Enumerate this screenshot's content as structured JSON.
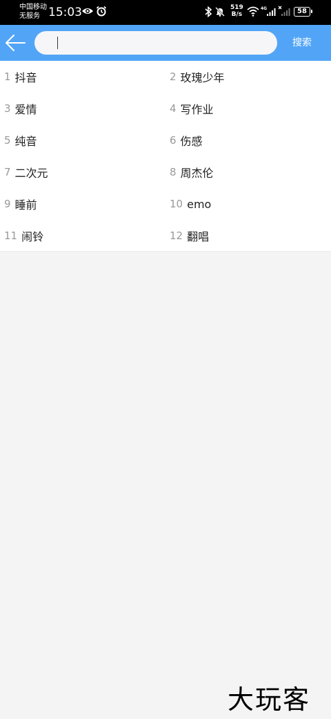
{
  "status": {
    "carrier_line1": "中国移动",
    "carrier_line2": "无服务",
    "time": "15:03",
    "net_speed_value": "519",
    "net_speed_unit": "B/s",
    "network_type": "4G",
    "battery": "58",
    "icons": [
      "eye-icon",
      "alarm-icon",
      "bluetooth-icon",
      "mute-bell-icon",
      "wifi-icon",
      "signal-icon",
      "no-signal-icon",
      "battery-icon"
    ]
  },
  "header": {
    "back_icon": "arrow-left-icon",
    "search_placeholder": "",
    "search_value": "",
    "search_button": "搜索",
    "accent_color": "#52a5f6"
  },
  "hot_searches": [
    {
      "num": "1",
      "label": "抖音"
    },
    {
      "num": "2",
      "label": "玫瑰少年"
    },
    {
      "num": "3",
      "label": "爱情"
    },
    {
      "num": "4",
      "label": "写作业"
    },
    {
      "num": "5",
      "label": "纯音"
    },
    {
      "num": "6",
      "label": "伤感"
    },
    {
      "num": "7",
      "label": "二次元"
    },
    {
      "num": "8",
      "label": "周杰伦"
    },
    {
      "num": "9",
      "label": "睡前"
    },
    {
      "num": "10",
      "label": "emo"
    },
    {
      "num": "11",
      "label": "闹铃"
    },
    {
      "num": "12",
      "label": "翻唱"
    }
  ],
  "watermark": "大玩客"
}
